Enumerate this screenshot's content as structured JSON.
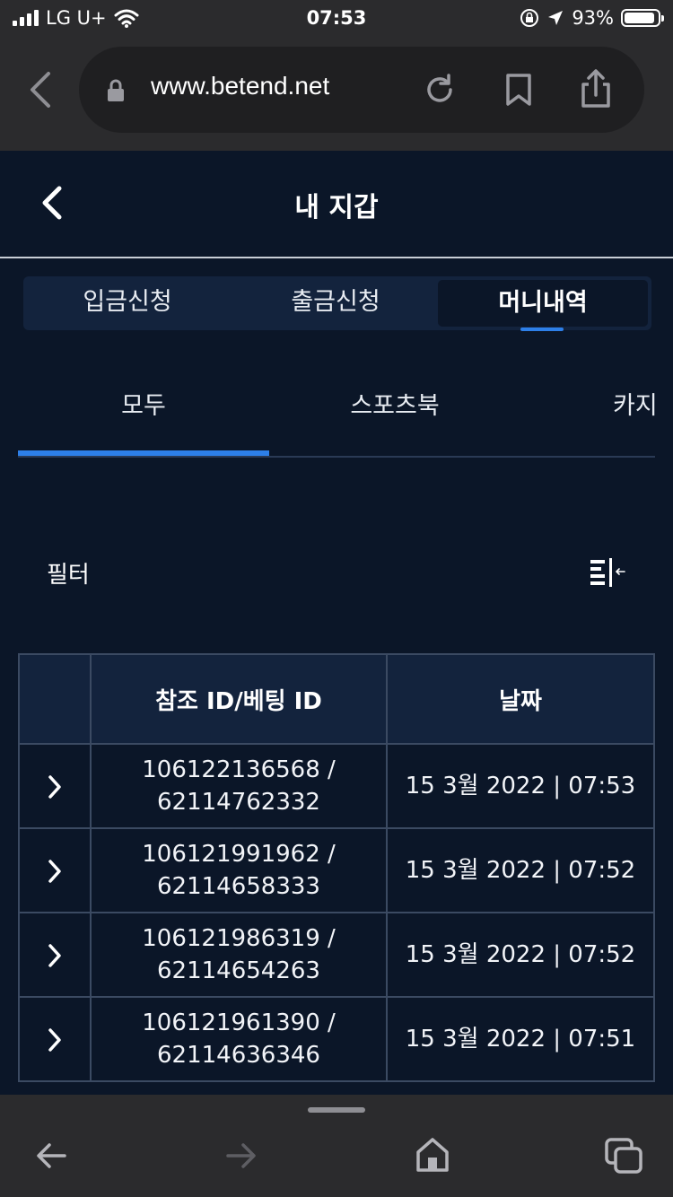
{
  "status_bar": {
    "carrier": "LG U+",
    "time": "07:53",
    "battery": "93%",
    "battery_level": 0.93
  },
  "browser": {
    "url": "www.betend.net"
  },
  "header": {
    "title": "내 지갑"
  },
  "main_tabs": [
    {
      "label": "입금신청",
      "active": false
    },
    {
      "label": "출금신청",
      "active": false
    },
    {
      "label": "머니내역",
      "active": true
    }
  ],
  "sub_tabs": [
    {
      "label": "모두",
      "active": true
    },
    {
      "label": "스포츠북",
      "active": false
    },
    {
      "label": "카지",
      "active": false
    }
  ],
  "filter": {
    "label": "필터"
  },
  "table": {
    "headers": [
      "",
      "참조 ID/베팅 ID",
      "날짜"
    ],
    "rows": [
      {
        "ref_id": "106122136568 /",
        "bet_id": "62114762332",
        "date": "15 3월 2022 | 07:53"
      },
      {
        "ref_id": "106121991962 /",
        "bet_id": "62114658333",
        "date": "15 3월 2022 | 07:52"
      },
      {
        "ref_id": "106121986319 /",
        "bet_id": "62114654263",
        "date": "15 3월 2022 | 07:52"
      },
      {
        "ref_id": "106121961390 /",
        "bet_id": "62114636346",
        "date": "15 3월 2022 | 07:51"
      }
    ]
  },
  "colors": {
    "background": "#0b1628",
    "accent": "#2d7fe8",
    "panel": "#13233d",
    "chrome": "#2b2b2d"
  }
}
